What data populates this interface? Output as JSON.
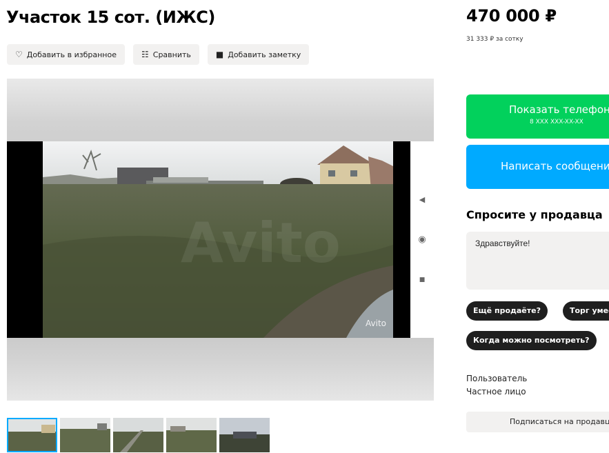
{
  "listing": {
    "title": "Участок 15 сот. (ИЖС)",
    "price": "470 000 ₽",
    "price_per_unit": "31 333 ₽ за сотку"
  },
  "actions": {
    "favorite_label": "Добавить в избранное",
    "compare_label": "Сравнить",
    "note_label": "Добавить заметку"
  },
  "gallery": {
    "watermark": "Avito",
    "thumbnails_count": 5,
    "active_thumbnail": 1
  },
  "contact": {
    "phone_button_label": "Показать телефон",
    "phone_masked": "8 XXX XXX-XX-XX",
    "message_button_label": "Написать сообщение"
  },
  "ask": {
    "heading": "Спросите у продавца",
    "message_text": "Здравствуйте!",
    "quick_replies": [
      "Ещё продаёте?",
      "Торг уместен?",
      "Когда можно посмотреть?"
    ]
  },
  "seller": {
    "name": "Пользователь",
    "type": "Частное лицо",
    "subscribe_label": "Подписаться на продавца"
  },
  "colors": {
    "accent_green": "#02d15c",
    "accent_blue": "#00aaff",
    "chip_dark": "#1f1f1f"
  }
}
